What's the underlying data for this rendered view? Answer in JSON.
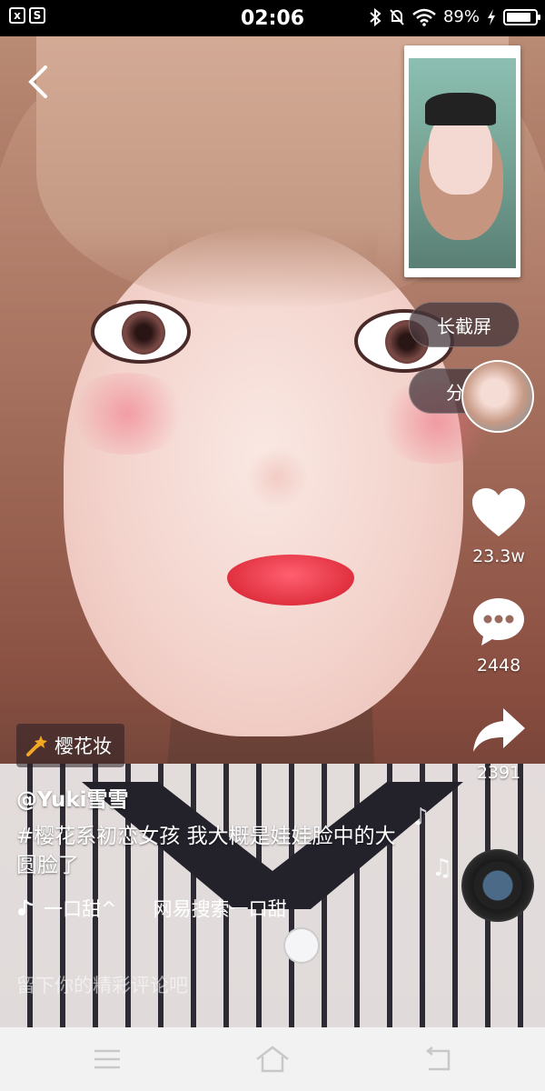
{
  "status_bar": {
    "time": "02:06",
    "battery_percent": "89%",
    "left_badges": [
      "x",
      "S"
    ],
    "icons": [
      "bluetooth-icon",
      "mute-bell-icon",
      "wifi-icon",
      "battery-icon",
      "charging-icon"
    ]
  },
  "overlay": {
    "long_screenshot_label": "长截屏",
    "share_label": "分享"
  },
  "actions": {
    "likes": "23.3w",
    "comments": "2448",
    "shares": "2391"
  },
  "effect": {
    "label": "樱花妆"
  },
  "post": {
    "author": "@Yuki雪雪",
    "caption": "#樱花系初恋女孩 我大概是娃娃脸中的大圆脸了",
    "music_title": "一口甜^",
    "music_artist": "网易搜索一口甜"
  },
  "comment": {
    "placeholder": "留下你的精彩评论吧"
  },
  "nav": {
    "buttons": [
      "menu-icon",
      "home-icon",
      "back-icon"
    ]
  }
}
